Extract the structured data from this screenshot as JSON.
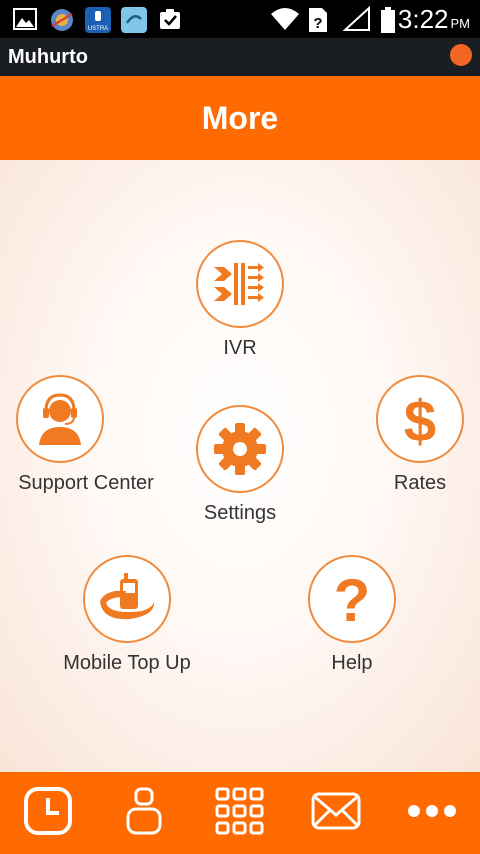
{
  "status_bar": {
    "time": "3:22",
    "ampm": "PM",
    "icons": [
      "image-icon",
      "weather-icon",
      "ustra-app-icon",
      "link-app-icon",
      "task-icon",
      "wifi-icon",
      "no-sim-icon",
      "signal-icon",
      "battery-icon"
    ],
    "ustra_label": "USTRA"
  },
  "app_bar": {
    "title": "Muhurto",
    "indicator_color": "#f26522"
  },
  "header": {
    "title": "More",
    "color": "#ff6b00"
  },
  "menu": {
    "ivr": {
      "label": "IVR",
      "icon": "ivr-icon"
    },
    "support_center": {
      "label": "Support Center",
      "icon": "headset-agent-icon"
    },
    "settings": {
      "label": "Settings",
      "icon": "gear-icon"
    },
    "rates": {
      "label": "Rates",
      "icon": "dollar-icon"
    },
    "mobile_top_up": {
      "label": "Mobile Top Up",
      "icon": "mobile-topup-icon"
    },
    "help": {
      "label": "Help",
      "icon": "question-icon"
    },
    "accent_color": "#f08a3c"
  },
  "bottom_bar": {
    "tabs": [
      {
        "name": "recents-tab",
        "icon": "clock-icon"
      },
      {
        "name": "contacts-tab",
        "icon": "person-icon"
      },
      {
        "name": "dialpad-tab",
        "icon": "dialpad-icon"
      },
      {
        "name": "messages-tab",
        "icon": "envelope-icon"
      },
      {
        "name": "more-tab",
        "icon": "more-dots-icon"
      }
    ]
  }
}
